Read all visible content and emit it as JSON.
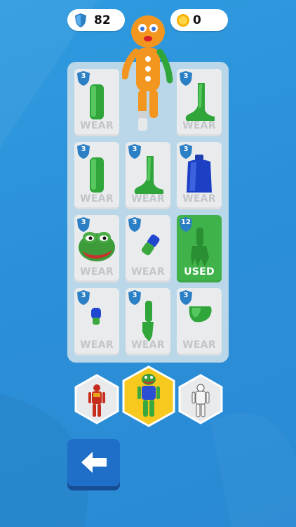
{
  "currency": {
    "gems": "82",
    "coins": "0"
  },
  "slots": [
    {
      "level": "3",
      "label": "WEAR",
      "item": "green-arm-piece"
    },
    {
      "level": "",
      "label": "",
      "item": "equipped-character"
    },
    {
      "level": "3",
      "label": "WEAR",
      "item": "green-foot"
    },
    {
      "level": "3",
      "label": "WEAR",
      "item": "green-arm-piece"
    },
    {
      "level": "3",
      "label": "WEAR",
      "item": "green-foot"
    },
    {
      "level": "3",
      "label": "WEAR",
      "item": "blue-shirt"
    },
    {
      "level": "3",
      "label": "WEAR",
      "item": "frog-head"
    },
    {
      "level": "3",
      "label": "WEAR",
      "item": "blue-green-small-piece"
    },
    {
      "level": "12",
      "label": "USED",
      "item": "green-hand"
    },
    {
      "level": "3",
      "label": "WEAR",
      "item": "blue-small-piece"
    },
    {
      "level": "3",
      "label": "WEAR",
      "item": "green-forearm"
    },
    {
      "level": "3",
      "label": "WEAR",
      "item": "green-chunk"
    }
  ],
  "characters": [
    {
      "name": "red-robot-character",
      "selected": false
    },
    {
      "name": "frog-character",
      "selected": true
    },
    {
      "name": "white-trooper-character",
      "selected": false
    }
  ],
  "colors": {
    "background": "#2b90d8",
    "used_slot": "#3fb34a",
    "selected_hex": "#f7c81e",
    "badge": "#2b7fc4"
  }
}
